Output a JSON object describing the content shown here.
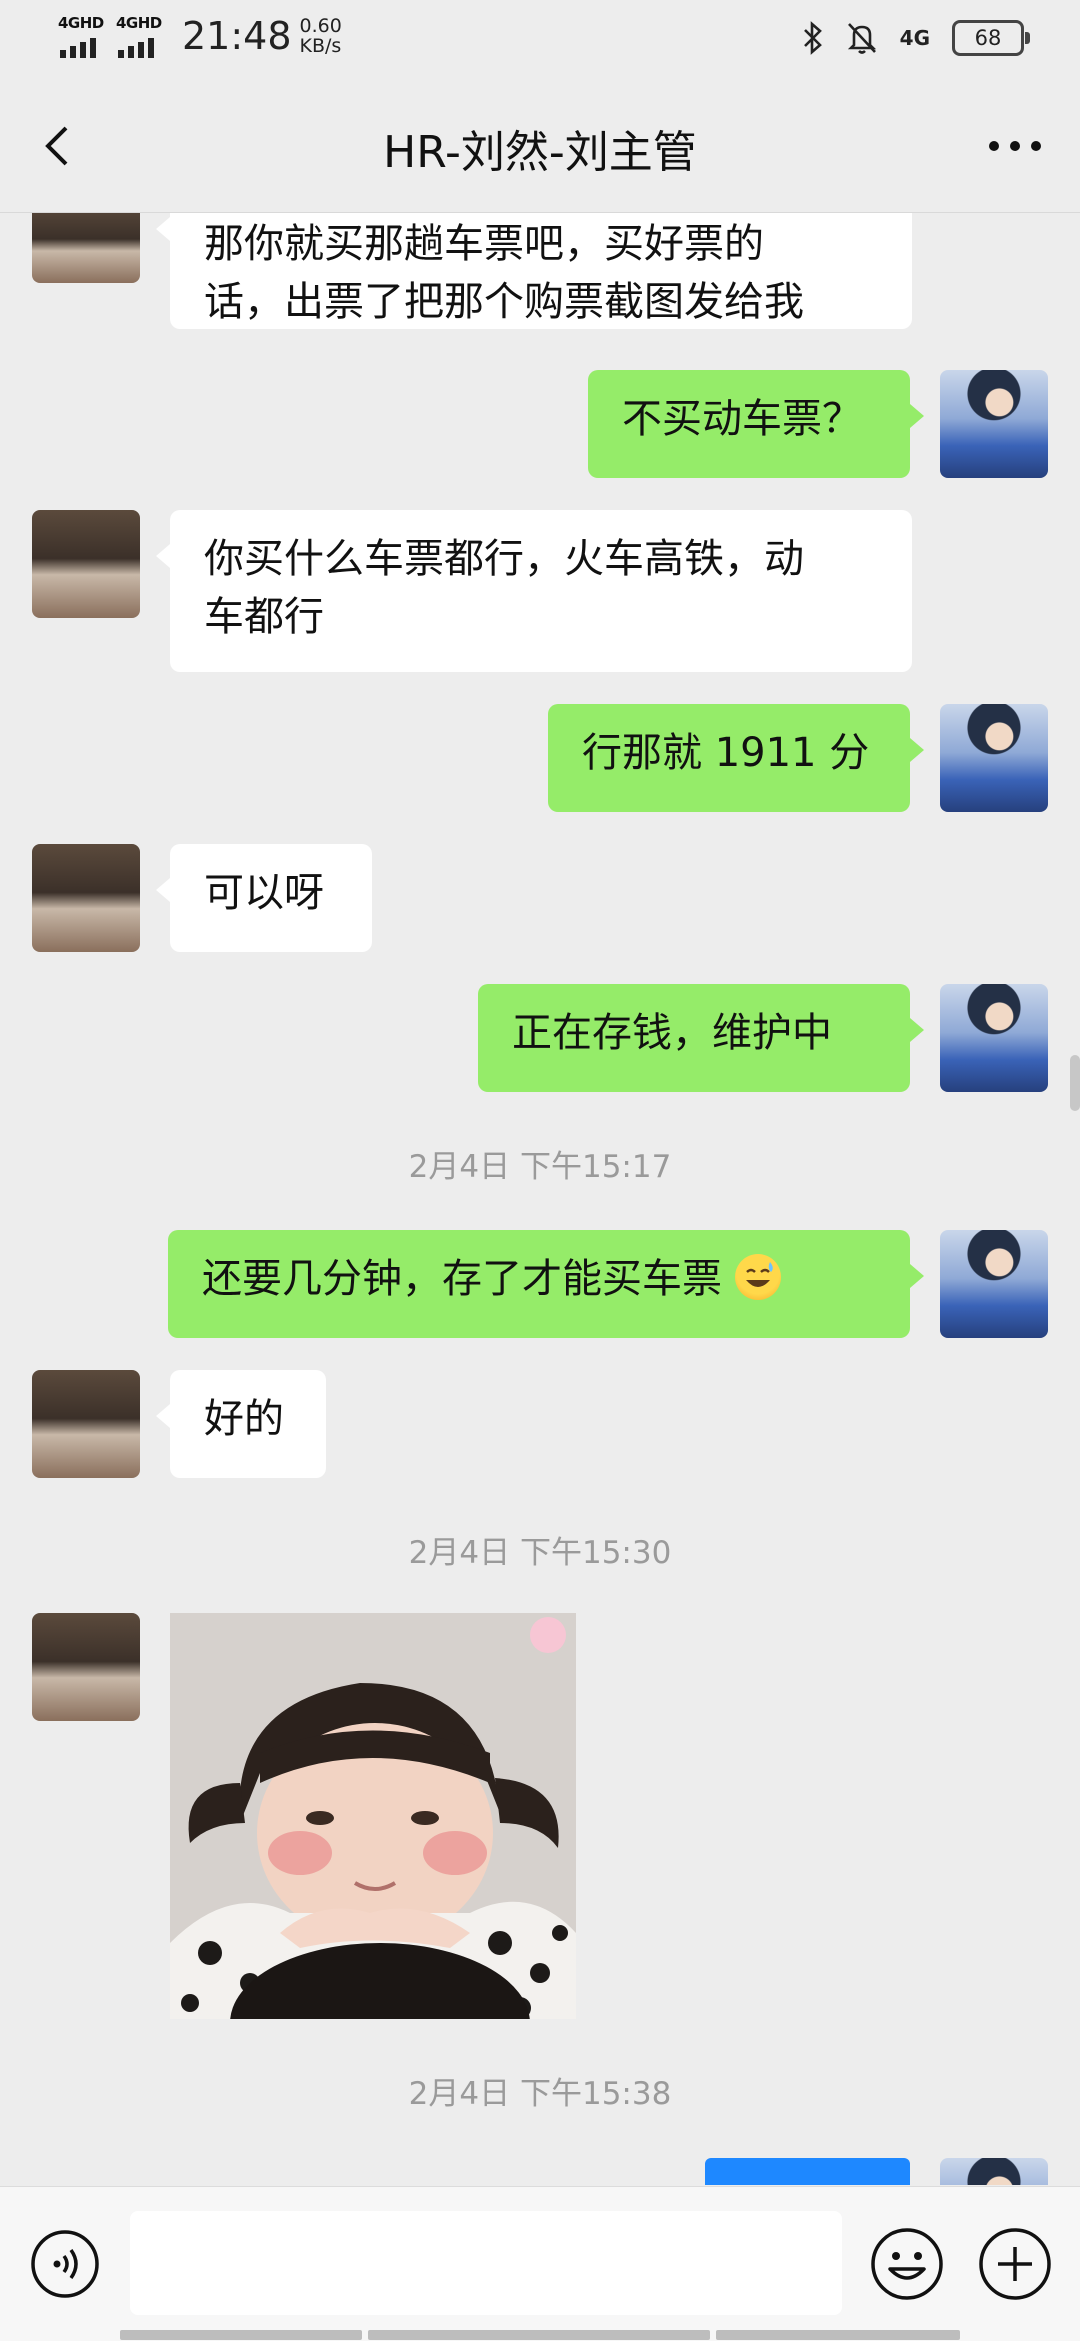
{
  "status_bar": {
    "network_1": "4GHD",
    "network_2": "4GHD",
    "time": "21:48",
    "speed_value": "0.60",
    "speed_unit": "KB/s",
    "net_4g": "4G",
    "battery": "68"
  },
  "header": {
    "title": "HR-刘然-刘主管"
  },
  "messages": {
    "m1_line1": "那你就买那趟车票吧，买好票的",
    "m1_line2": "话，出票了把那个购票截图发给我",
    "m2": "不买动车票？",
    "m3_line1": "你买什么车票都行，火车高铁，动",
    "m3_line2": "车都行",
    "m4": "行那就 1911 分",
    "m5": "可以呀",
    "m6": "正在存钱，维护中",
    "ts1": "2月4日 下午15:17",
    "m7": "还要几分钟，存了才能买车票",
    "m8": "好的",
    "ts2": "2月4日 下午15:30",
    "ts3": "2月4日 下午15:38"
  },
  "input": {
    "value": "",
    "placeholder": ""
  },
  "icons": [
    "back-icon",
    "more-icon",
    "voice-icon",
    "emoji-icon",
    "plus-icon",
    "bluetooth-icon",
    "mute-icon"
  ]
}
